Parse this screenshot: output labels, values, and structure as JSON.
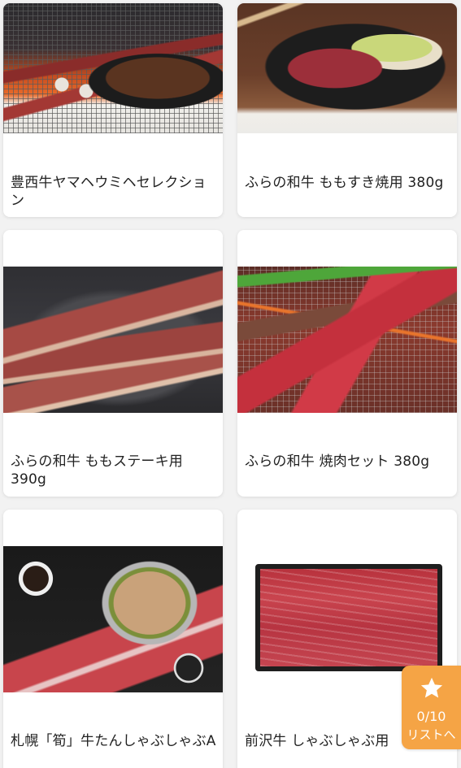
{
  "products": [
    {
      "title": "豊西牛ヤマヘウミヘセレクション",
      "image": "grill-photo"
    },
    {
      "title": "ふらの和牛 ももすき焼用 380g",
      "image": "sukiyaki-photo"
    },
    {
      "title": "ふらの和牛 ももステーキ用 390g",
      "image": "steak-photo"
    },
    {
      "title": "ふらの和牛 焼肉セット 380g",
      "image": "yakiniku-photo"
    },
    {
      "title": "札幌「筍」牛たんしゃぶしゃぶA",
      "image": "shabu-hotpot-photo"
    },
    {
      "title": "前沢牛 しゃぶしゃぶ用",
      "image": "sliced-beef-tray-photo"
    }
  ],
  "list_button": {
    "count": "0/10",
    "label": "リストへ",
    "icon": "star-icon",
    "color": "#f5a445"
  }
}
